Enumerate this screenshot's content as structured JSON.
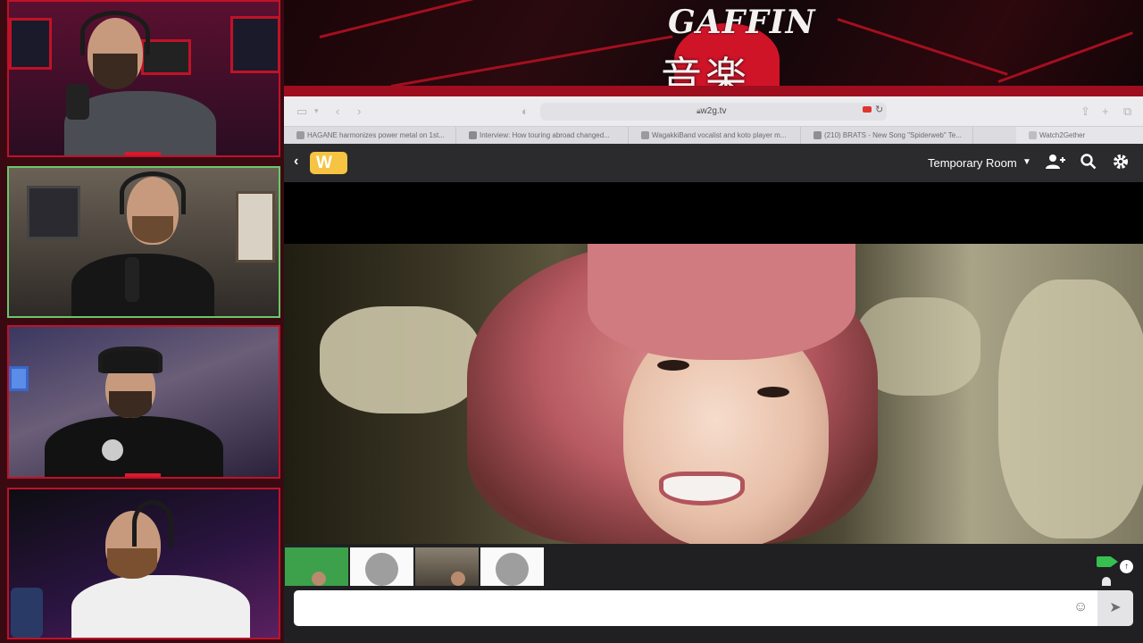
{
  "banner": {
    "logo_text": "GAFFIN",
    "logo_kanji": "音楽"
  },
  "browser": {
    "url": "w2g.tv",
    "tabs": [
      {
        "label": "HAGANE harmonizes power metal on 1st..."
      },
      {
        "label": "Interview: How touring abroad changed..."
      },
      {
        "label": "WagakkiBand vocalist and koto player m..."
      },
      {
        "label": "(210) BRATS - New Song \"Spiderweb\" Te..."
      },
      {
        "label": "Watch2Gether"
      }
    ]
  },
  "w2g": {
    "logo_letter": "W",
    "room_name": "Temporary Room",
    "chat_placeholder": ""
  },
  "colors": {
    "accent_red": "#c01228",
    "w2g_yellow": "#f6c343",
    "webcam_green": "#36c050"
  },
  "icons": {
    "back": "chevron-left-icon",
    "add_user": "add-user-icon",
    "search": "search-icon",
    "settings": "gear-icon",
    "emoji": "emoji-icon",
    "send": "send-icon"
  }
}
